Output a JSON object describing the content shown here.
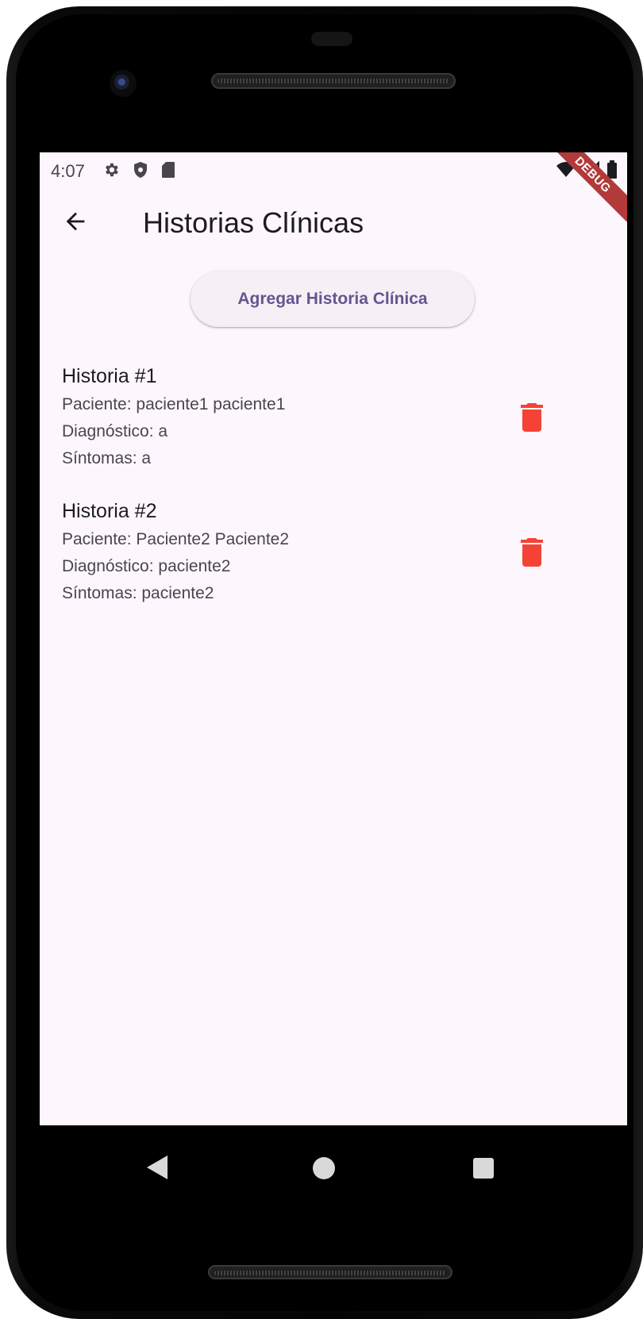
{
  "status_bar": {
    "time": "4:07",
    "left_icons": [
      "settings-icon",
      "shield-icon",
      "sd-card-icon"
    ],
    "right_icons": [
      "wifi-icon",
      "signal-icon",
      "battery-icon"
    ]
  },
  "debug_banner": "DEBUG",
  "app_bar": {
    "title": "Historias Clínicas",
    "back_icon": "arrow-left-icon"
  },
  "add_button_label": "Agregar Historia Clínica",
  "records": [
    {
      "title": "Historia #1",
      "paciente": "Paciente: paciente1 paciente1",
      "diagnostico": "Diagnóstico: a",
      "sintomas": "Síntomas: a",
      "delete_icon": "trash-icon"
    },
    {
      "title": "Historia #2",
      "paciente": "Paciente: Paciente2 Paciente2",
      "diagnostico": "Diagnóstico: paciente2",
      "sintomas": "Síntomas: paciente2",
      "delete_icon": "trash-icon"
    }
  ],
  "nav_bar": {
    "back_icon": "nav-back-icon",
    "home_icon": "nav-home-icon",
    "recents_icon": "nav-recents-icon"
  },
  "colors": {
    "background": "#fdf7fd",
    "button_bg": "#f6eff6",
    "button_text": "#65558f",
    "delete": "#f44336",
    "title_text": "#1d1b20",
    "body_text": "#49454f",
    "debug_banner": "#b23a3a"
  }
}
